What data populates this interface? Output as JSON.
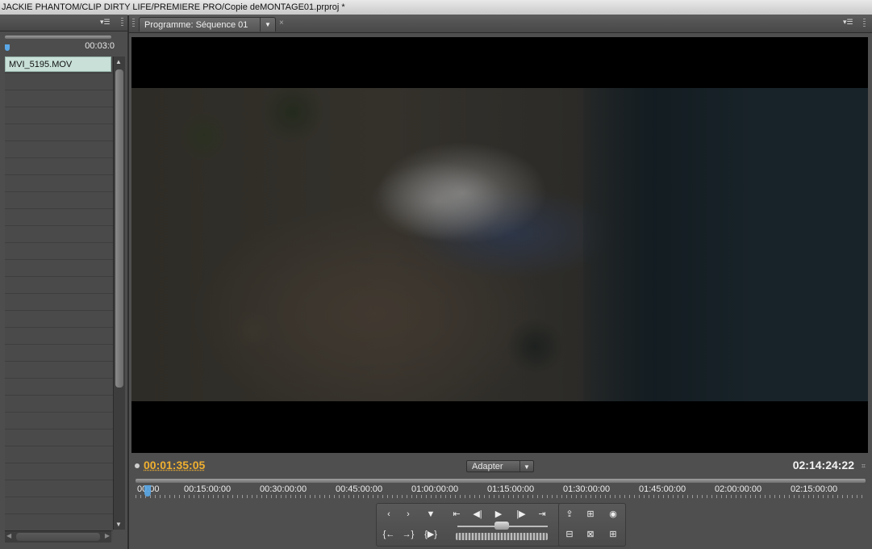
{
  "window": {
    "title": "JACKIE PHANTOM/CLIP DIRTY LIFE/PREMIERE PRO/Copie deMONTAGE01.prproj *"
  },
  "source_panel": {
    "timecode": "00:03:0",
    "clips": [
      "MVI_5195.MOV"
    ]
  },
  "program_monitor": {
    "tab_label": "Programme: Séquence 01",
    "current_timecode": "00:01:35:05",
    "fit_value": "Adapter",
    "duration_timecode": "02:14:24:22",
    "ruler_labels": [
      "00:00",
      "00:15:00:00",
      "00:30:00:00",
      "00:45:00:00",
      "01:00:00:00",
      "01:15:00:00",
      "01:30:00:00",
      "01:45:00:00",
      "02:00:00:00",
      "02:15:00:00"
    ],
    "playhead_fraction": 0.012
  },
  "controls": {
    "row1": [
      "mark-in-icon",
      "mark-out-icon",
      "add-marker-icon",
      "go-to-in-icon",
      "step-back-icon",
      "play-icon",
      "step-forward-icon",
      "go-to-out-icon"
    ],
    "row2": [
      "go-to-previous-edit-icon",
      "go-to-next-edit-icon",
      "play-in-to-out-icon"
    ],
    "right": [
      "lift-icon",
      "extract-icon",
      "export-frame-icon",
      "safe-margins-icon",
      "output-icon",
      "trim-icon"
    ]
  }
}
